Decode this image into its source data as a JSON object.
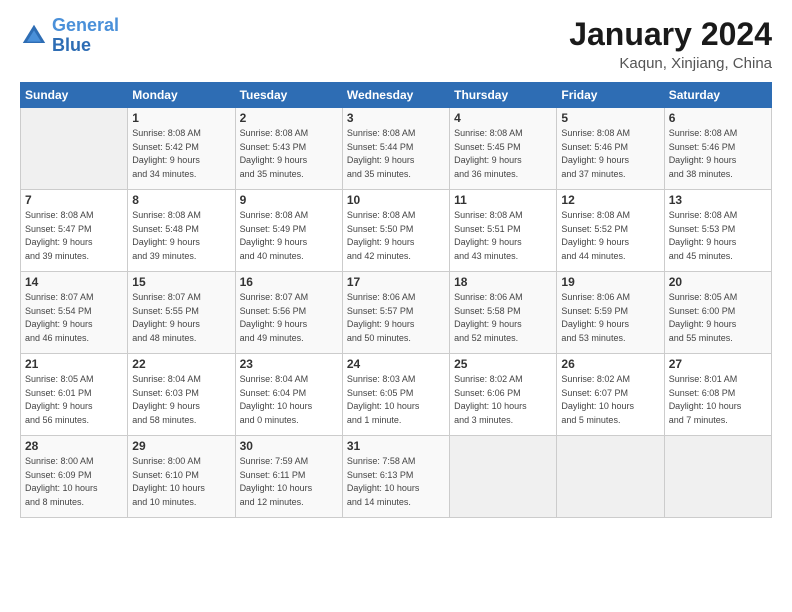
{
  "header": {
    "logo_line1": "General",
    "logo_line2": "Blue",
    "month": "January 2024",
    "location": "Kaqun, Xinjiang, China"
  },
  "weekdays": [
    "Sunday",
    "Monday",
    "Tuesday",
    "Wednesday",
    "Thursday",
    "Friday",
    "Saturday"
  ],
  "weeks": [
    [
      {
        "day": "",
        "info": ""
      },
      {
        "day": "1",
        "info": "Sunrise: 8:08 AM\nSunset: 5:42 PM\nDaylight: 9 hours\nand 34 minutes."
      },
      {
        "day": "2",
        "info": "Sunrise: 8:08 AM\nSunset: 5:43 PM\nDaylight: 9 hours\nand 35 minutes."
      },
      {
        "day": "3",
        "info": "Sunrise: 8:08 AM\nSunset: 5:44 PM\nDaylight: 9 hours\nand 35 minutes."
      },
      {
        "day": "4",
        "info": "Sunrise: 8:08 AM\nSunset: 5:45 PM\nDaylight: 9 hours\nand 36 minutes."
      },
      {
        "day": "5",
        "info": "Sunrise: 8:08 AM\nSunset: 5:46 PM\nDaylight: 9 hours\nand 37 minutes."
      },
      {
        "day": "6",
        "info": "Sunrise: 8:08 AM\nSunset: 5:46 PM\nDaylight: 9 hours\nand 38 minutes."
      }
    ],
    [
      {
        "day": "7",
        "info": "Sunrise: 8:08 AM\nSunset: 5:47 PM\nDaylight: 9 hours\nand 39 minutes."
      },
      {
        "day": "8",
        "info": "Sunrise: 8:08 AM\nSunset: 5:48 PM\nDaylight: 9 hours\nand 39 minutes."
      },
      {
        "day": "9",
        "info": "Sunrise: 8:08 AM\nSunset: 5:49 PM\nDaylight: 9 hours\nand 40 minutes."
      },
      {
        "day": "10",
        "info": "Sunrise: 8:08 AM\nSunset: 5:50 PM\nDaylight: 9 hours\nand 42 minutes."
      },
      {
        "day": "11",
        "info": "Sunrise: 8:08 AM\nSunset: 5:51 PM\nDaylight: 9 hours\nand 43 minutes."
      },
      {
        "day": "12",
        "info": "Sunrise: 8:08 AM\nSunset: 5:52 PM\nDaylight: 9 hours\nand 44 minutes."
      },
      {
        "day": "13",
        "info": "Sunrise: 8:08 AM\nSunset: 5:53 PM\nDaylight: 9 hours\nand 45 minutes."
      }
    ],
    [
      {
        "day": "14",
        "info": "Sunrise: 8:07 AM\nSunset: 5:54 PM\nDaylight: 9 hours\nand 46 minutes."
      },
      {
        "day": "15",
        "info": "Sunrise: 8:07 AM\nSunset: 5:55 PM\nDaylight: 9 hours\nand 48 minutes."
      },
      {
        "day": "16",
        "info": "Sunrise: 8:07 AM\nSunset: 5:56 PM\nDaylight: 9 hours\nand 49 minutes."
      },
      {
        "day": "17",
        "info": "Sunrise: 8:06 AM\nSunset: 5:57 PM\nDaylight: 9 hours\nand 50 minutes."
      },
      {
        "day": "18",
        "info": "Sunrise: 8:06 AM\nSunset: 5:58 PM\nDaylight: 9 hours\nand 52 minutes."
      },
      {
        "day": "19",
        "info": "Sunrise: 8:06 AM\nSunset: 5:59 PM\nDaylight: 9 hours\nand 53 minutes."
      },
      {
        "day": "20",
        "info": "Sunrise: 8:05 AM\nSunset: 6:00 PM\nDaylight: 9 hours\nand 55 minutes."
      }
    ],
    [
      {
        "day": "21",
        "info": "Sunrise: 8:05 AM\nSunset: 6:01 PM\nDaylight: 9 hours\nand 56 minutes."
      },
      {
        "day": "22",
        "info": "Sunrise: 8:04 AM\nSunset: 6:03 PM\nDaylight: 9 hours\nand 58 minutes."
      },
      {
        "day": "23",
        "info": "Sunrise: 8:04 AM\nSunset: 6:04 PM\nDaylight: 10 hours\nand 0 minutes."
      },
      {
        "day": "24",
        "info": "Sunrise: 8:03 AM\nSunset: 6:05 PM\nDaylight: 10 hours\nand 1 minute."
      },
      {
        "day": "25",
        "info": "Sunrise: 8:02 AM\nSunset: 6:06 PM\nDaylight: 10 hours\nand 3 minutes."
      },
      {
        "day": "26",
        "info": "Sunrise: 8:02 AM\nSunset: 6:07 PM\nDaylight: 10 hours\nand 5 minutes."
      },
      {
        "day": "27",
        "info": "Sunrise: 8:01 AM\nSunset: 6:08 PM\nDaylight: 10 hours\nand 7 minutes."
      }
    ],
    [
      {
        "day": "28",
        "info": "Sunrise: 8:00 AM\nSunset: 6:09 PM\nDaylight: 10 hours\nand 8 minutes."
      },
      {
        "day": "29",
        "info": "Sunrise: 8:00 AM\nSunset: 6:10 PM\nDaylight: 10 hours\nand 10 minutes."
      },
      {
        "day": "30",
        "info": "Sunrise: 7:59 AM\nSunset: 6:11 PM\nDaylight: 10 hours\nand 12 minutes."
      },
      {
        "day": "31",
        "info": "Sunrise: 7:58 AM\nSunset: 6:13 PM\nDaylight: 10 hours\nand 14 minutes."
      },
      {
        "day": "",
        "info": ""
      },
      {
        "day": "",
        "info": ""
      },
      {
        "day": "",
        "info": ""
      }
    ]
  ]
}
